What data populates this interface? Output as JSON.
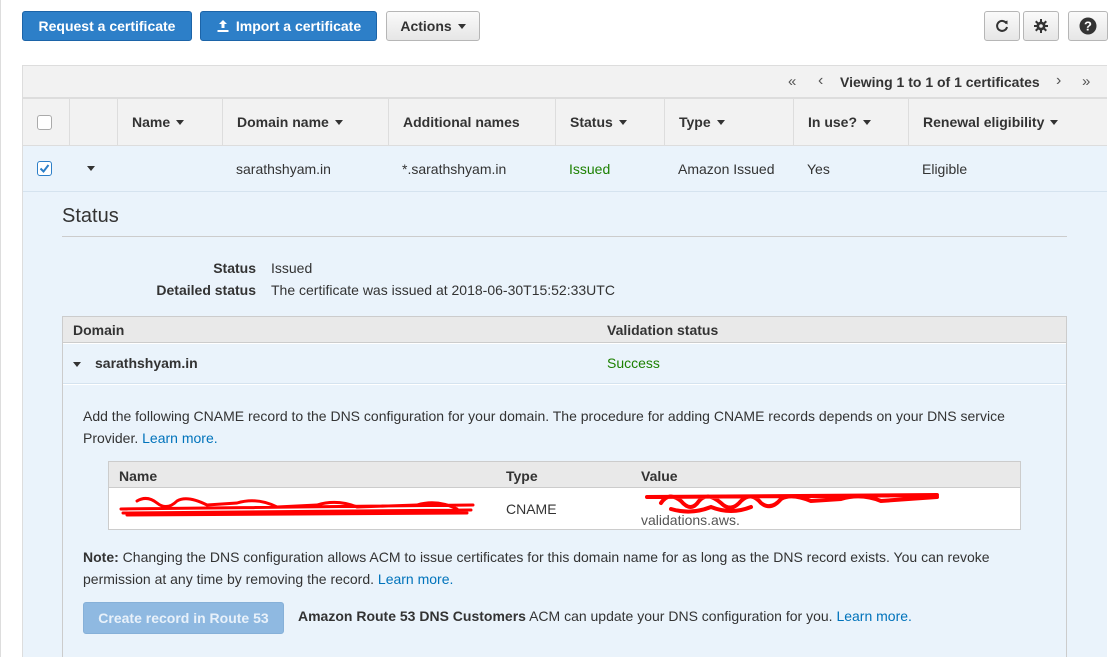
{
  "toolbar": {
    "request_label": "Request a certificate",
    "import_label": "Import a certificate",
    "actions_label": "Actions"
  },
  "pagination": {
    "text": "Viewing 1 to 1 of 1 certificates",
    "first": "«",
    "prev": "‹",
    "next": "›",
    "last": "»"
  },
  "table": {
    "columns": [
      "Name",
      "Domain name",
      "Additional names",
      "Status",
      "Type",
      "In use?",
      "Renewal eligibility"
    ],
    "rows": [
      {
        "name": "",
        "domain": "sarathshyam.in",
        "additional": "*.sarathshyam.in",
        "status": "Issued",
        "type": "Amazon Issued",
        "in_use": "Yes",
        "renewal": "Eligible"
      }
    ]
  },
  "detail": {
    "section_title": "Status",
    "status_label": "Status",
    "status_value": "Issued",
    "detailed_label": "Detailed status",
    "detailed_value": "The certificate was issued at 2018-06-30T15:52:33UTC",
    "validation": {
      "col_domain": "Domain",
      "col_status": "Validation status",
      "domain": "sarathshyam.in",
      "status": "Success",
      "cname_text": "Add the following CNAME record to the DNS configuration for your domain. The procedure for adding CNAME records depends on your DNS service Provider.",
      "learn_more": "Learn more.",
      "record": {
        "col_name": "Name",
        "col_type": "Type",
        "col_value": "Value",
        "type": "CNAME",
        "value_suffix": "validations.aws."
      },
      "note_label": "Note:",
      "note_text": "Changing the DNS configuration allows ACM to issue certificates for this domain name for as long as the DNS record exists. You can revoke permission at any time by removing the record.",
      "note_learn_more": "Learn more.",
      "route53_button": "Create record in Route 53",
      "route53_bold": "Amazon Route 53 DNS Customers",
      "route53_text": "ACM can update your DNS configuration for you.",
      "route53_learn_more": "Learn more."
    }
  },
  "colors": {
    "primary": "#2d7fc8",
    "success": "#1d8102",
    "link": "#0073bb",
    "selected_row": "#eaf3fb",
    "redaction": "#ff0000"
  }
}
